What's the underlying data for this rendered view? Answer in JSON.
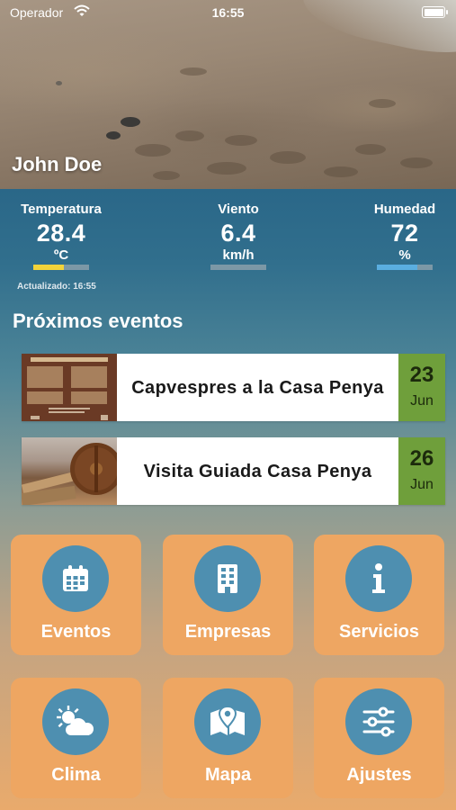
{
  "status_bar": {
    "carrier": "Operador",
    "time": "16:55"
  },
  "header": {
    "user_name": "John Doe"
  },
  "weather": {
    "temperature": {
      "label": "Temperatura",
      "value": "28.4",
      "unit": "ºC",
      "level": 0.55,
      "bar_color": "#f2d33a"
    },
    "wind": {
      "label": "Viento",
      "value": "6.4",
      "unit": "km/h",
      "level": 0.0,
      "bar_color": "#7fb2d6"
    },
    "humidity": {
      "label": "Humedad",
      "value": "72",
      "unit": "%",
      "level": 0.72,
      "bar_color": "#5aaee0"
    },
    "updated": "Actualizado: 16:55"
  },
  "events": {
    "title": "Próximos eventos",
    "items": [
      {
        "name": "Capvespres a la Casa Penya",
        "day": "23",
        "month": "Jun",
        "thumbnail": "event-poster"
      },
      {
        "name": "Visita Guiada Casa Penya",
        "day": "26",
        "month": "Jun",
        "thumbnail": "mill-photo"
      }
    ],
    "date_color": "#6f9f3b"
  },
  "menu": {
    "tiles": [
      {
        "label": "Eventos",
        "icon": "calendar-icon"
      },
      {
        "label": "Empresas",
        "icon": "building-icon"
      },
      {
        "label": "Servicios",
        "icon": "info-icon"
      },
      {
        "label": "Clima",
        "icon": "weather-icon"
      },
      {
        "label": "Mapa",
        "icon": "map-icon"
      },
      {
        "label": "Ajustes",
        "icon": "sliders-icon"
      }
    ],
    "tile_color": "#eea662",
    "circle_color": "#4e8fb0"
  }
}
